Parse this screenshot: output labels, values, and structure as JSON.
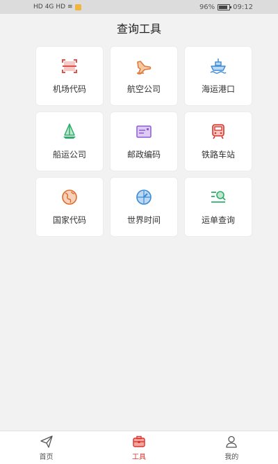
{
  "status_bar": {
    "left_indicators": [
      "HD",
      "4G",
      "HD"
    ],
    "battery": "96%",
    "time": "09:12"
  },
  "header": {
    "title": "查询工具"
  },
  "tools": [
    {
      "label": "机场代码",
      "icon": "scan-icon",
      "color": "#e0524c"
    },
    {
      "label": "航空公司",
      "icon": "airplane-icon",
      "color": "#e07a3a"
    },
    {
      "label": "海运港口",
      "icon": "ship-icon",
      "color": "#3a8ad6"
    },
    {
      "label": "船运公司",
      "icon": "sailboat-icon",
      "color": "#2fae6b"
    },
    {
      "label": "邮政编码",
      "icon": "postcard-icon",
      "color": "#8e5bd1"
    },
    {
      "label": "铁路车站",
      "icon": "train-icon",
      "color": "#d9342b"
    },
    {
      "label": "国家代码",
      "icon": "globe-icon",
      "color": "#e06a2b"
    },
    {
      "label": "世界时间",
      "icon": "compass-icon",
      "color": "#3a8ad6"
    },
    {
      "label": "运单查询",
      "icon": "search-list-icon",
      "color": "#2fae6b"
    }
  ],
  "bottom_nav": [
    {
      "label": "首页",
      "icon": "send-icon",
      "active": false
    },
    {
      "label": "工具",
      "icon": "toolbox-icon",
      "active": true
    },
    {
      "label": "我的",
      "icon": "user-icon",
      "active": false
    }
  ],
  "colors": {
    "accent": "#d9342b",
    "background": "#f2f2f2"
  }
}
